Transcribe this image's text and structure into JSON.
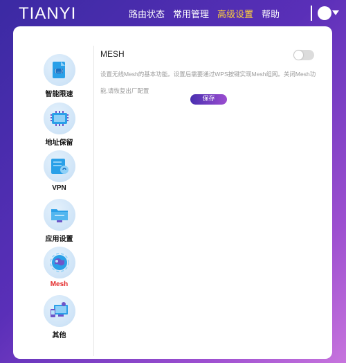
{
  "brand": "TIANYI",
  "nav": [
    {
      "label": "路由状态",
      "active": false
    },
    {
      "label": "常用管理",
      "active": false
    },
    {
      "label": "高级设置",
      "active": true
    },
    {
      "label": "帮助",
      "active": false
    }
  ],
  "sidebar": {
    "items": [
      {
        "label": "智能限速",
        "icon": "speed-limit-icon",
        "active": false
      },
      {
        "label": "地址保留",
        "icon": "address-reserve-icon",
        "active": false
      },
      {
        "label": "VPN",
        "icon": "vpn-icon",
        "active": false
      },
      {
        "label": "应用设置",
        "icon": "app-settings-icon",
        "active": false
      },
      {
        "label": "Mesh",
        "icon": "mesh-icon",
        "active": true
      },
      {
        "label": "其他",
        "icon": "other-icon",
        "active": false
      }
    ]
  },
  "main": {
    "title": "MESH",
    "toggle_on": false,
    "description": "设置无线Mesh的基本功能。设置后需要通过WPS按键实现Mesh组网。关闭Mesh功能,请恢复出厂配置",
    "save_label": "保存"
  },
  "colors": {
    "accent": "#ffd23a",
    "active_sidebar": "#e32a2a",
    "button_start": "#4a2fb0",
    "button_end": "#9b4dd0"
  }
}
